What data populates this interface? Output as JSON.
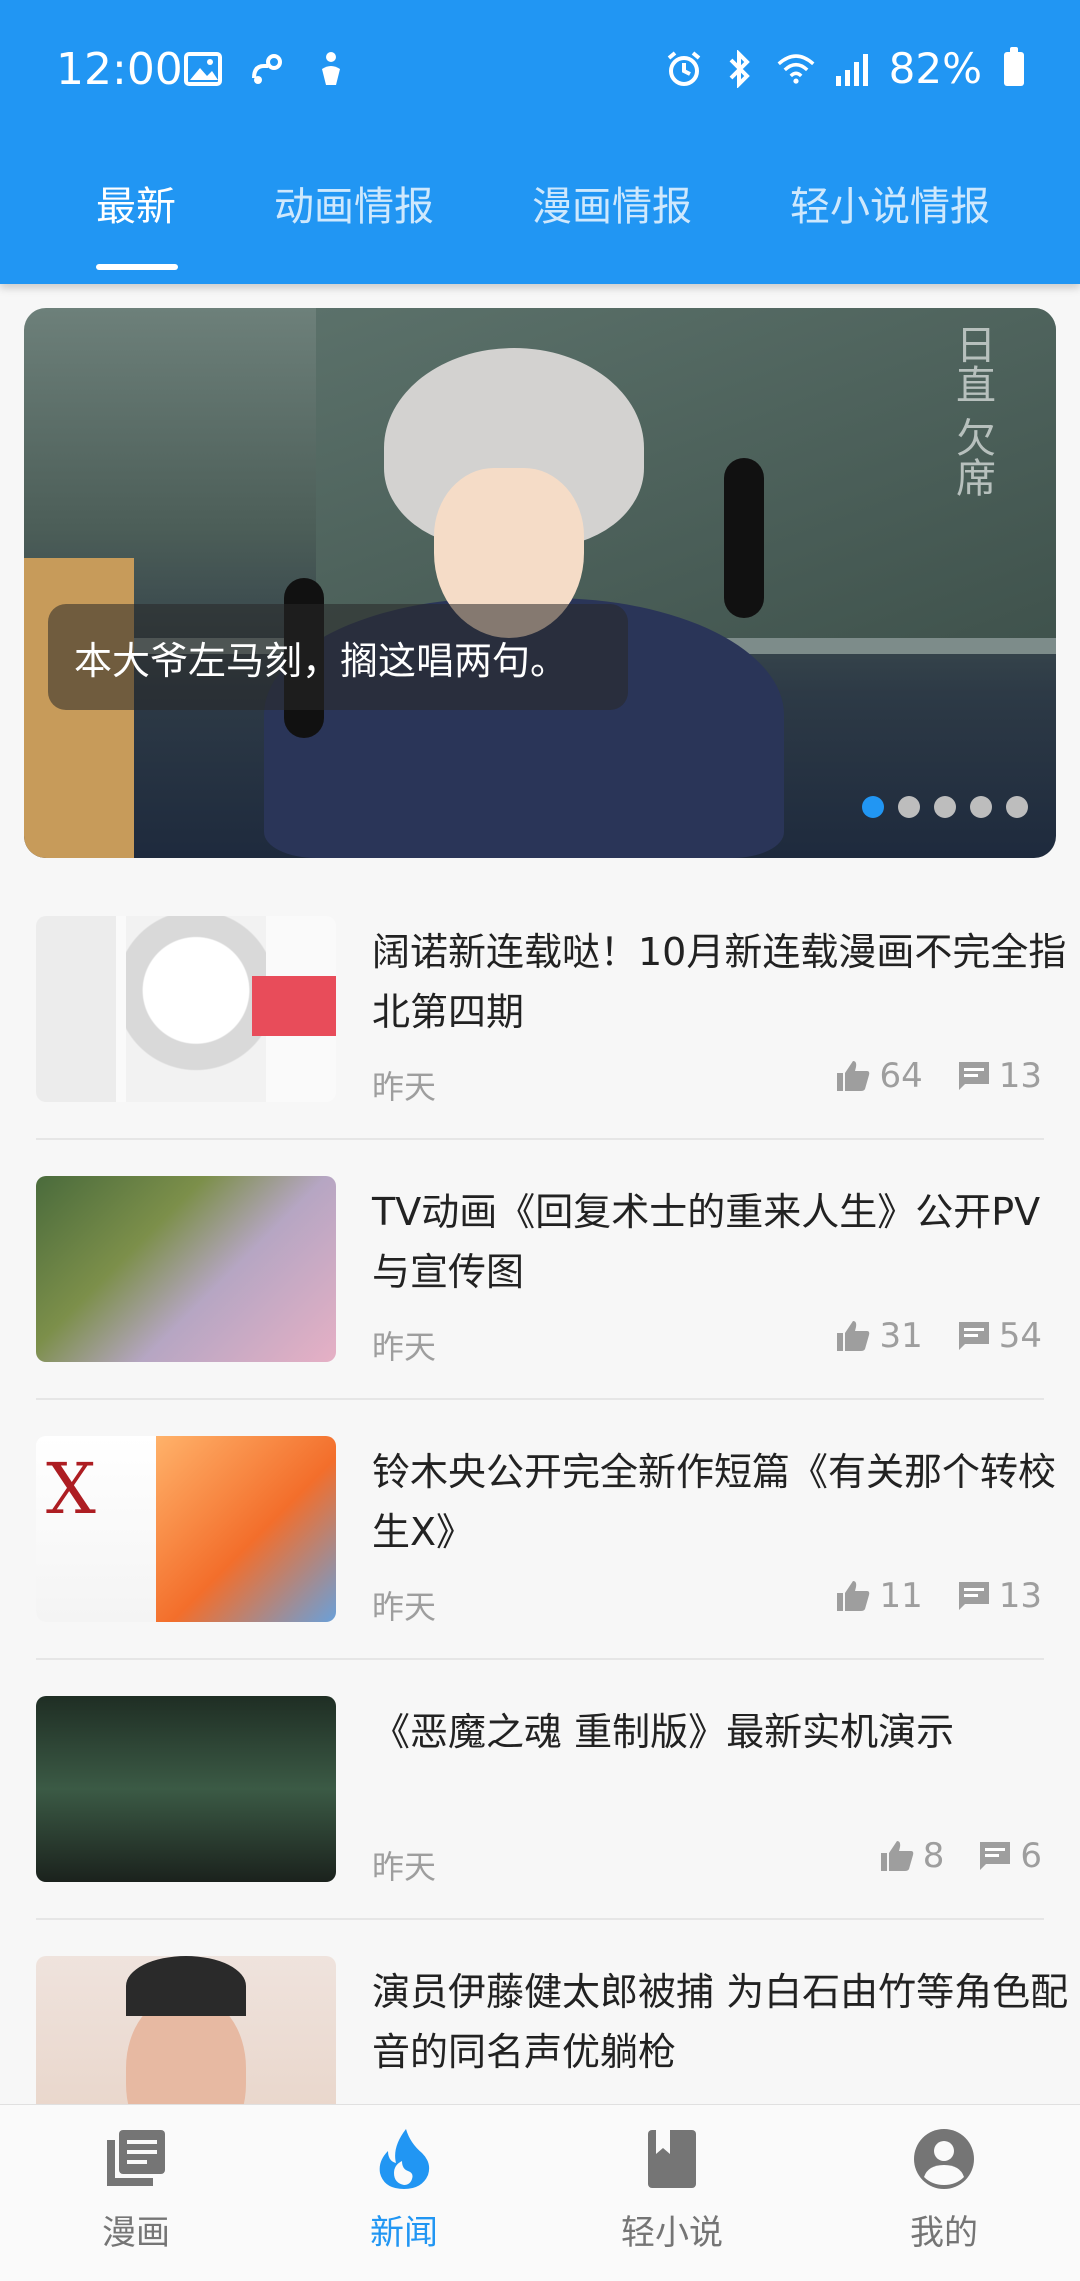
{
  "status_bar": {
    "time": "12:00",
    "battery": "82%"
  },
  "tabs": [
    {
      "label": "最新",
      "active": true
    },
    {
      "label": "动画情报",
      "active": false
    },
    {
      "label": "漫画情报",
      "active": false
    },
    {
      "label": "轻小说情报",
      "active": false
    }
  ],
  "banner": {
    "caption": "本大爷左马刻，搁这唱两句。",
    "kanji": "日直 欠席",
    "dot_count": 5,
    "active_dot": 0
  },
  "feed": [
    {
      "title": "阔诺新连载哒！10月新连载漫画不完全指北第四期",
      "date": "昨天",
      "likes": "64",
      "comments": "13"
    },
    {
      "title": "TV动画《回复术士的重来人生》公开PV与宣传图",
      "date": "昨天",
      "likes": "31",
      "comments": "54"
    },
    {
      "title": "铃木央公开完全新作短篇《有关那个转校生X》",
      "date": "昨天",
      "likes": "11",
      "comments": "13",
      "thumb_text": "X"
    },
    {
      "title": "《恶魔之魂 重制版》最新实机演示",
      "date": "昨天",
      "likes": "8",
      "comments": "6"
    },
    {
      "title": "演员伊藤健太郎被捕 为白石由竹等角色配音的同名声优躺枪",
      "date": "",
      "likes": "",
      "comments": ""
    }
  ],
  "bottom_nav": [
    {
      "label": "漫画",
      "icon": "library-book-icon",
      "active": false
    },
    {
      "label": "新闻",
      "icon": "flame-icon",
      "active": true
    },
    {
      "label": "轻小说",
      "icon": "book-icon",
      "active": false
    },
    {
      "label": "我的",
      "icon": "account-circle-icon",
      "active": false
    }
  ],
  "colors": {
    "primary": "#2196f3",
    "text": "#222222",
    "meta": "#9e9e9e"
  }
}
